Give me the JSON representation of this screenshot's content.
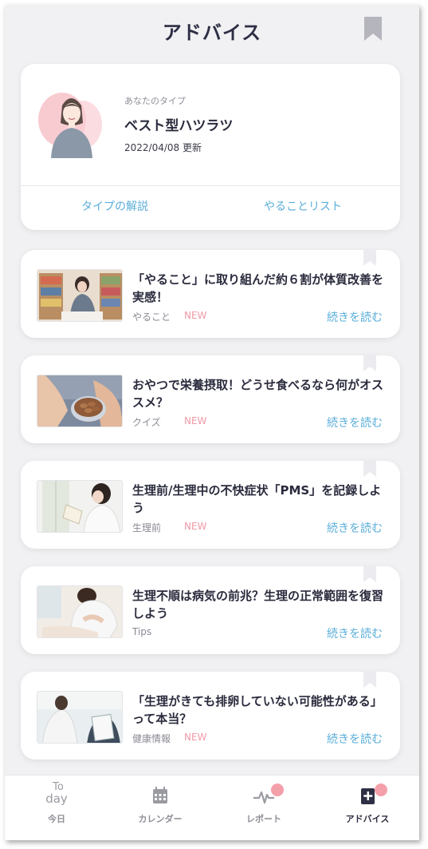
{
  "header": {
    "title": "アドバイス"
  },
  "type_card": {
    "caption": "あなたのタイプ",
    "name": "ベスト型ハツラツ",
    "updated": "2022/04/08 更新",
    "link_explanation": "タイプの解説",
    "link_todo": "やることリスト"
  },
  "articles": [
    {
      "title": "「やること」に取り組んだ約６割が体質改善を実感！",
      "category": "やること",
      "badge": "NEW",
      "more": "続きを読む"
    },
    {
      "title": "おやつで栄養摂取！どうせ食べるなら何がオススメ？",
      "category": "クイズ",
      "badge": "NEW",
      "more": "続きを読む"
    },
    {
      "title": "生理前/生理中の不快症状「PMS」を記録しよう",
      "category": "生理前",
      "badge": "NEW",
      "more": "続きを読む"
    },
    {
      "title": "生理不順は病気の前兆？生理の正常範囲を復習しよう",
      "category": "Tips",
      "badge": "",
      "more": "続きを読む"
    },
    {
      "title": "「生理がきても排卵していない可能性がある」って本当？",
      "category": "健康情報",
      "badge": "NEW",
      "more": "続きを読む"
    }
  ],
  "tabbar": {
    "today_icon_line1": "To",
    "today_icon_line2": "day",
    "today": "今日",
    "calendar": "カレンダー",
    "report": "レポート",
    "advice": "アドバイス"
  },
  "colors": {
    "accent_link": "#5aaed9",
    "new_badge": "#f09aa6",
    "notification_dot": "#f4a0aa",
    "background": "#f1f1f3"
  },
  "icons": [
    "bookmark-icon",
    "calendar-icon",
    "pulse-icon",
    "advice-plus-icon"
  ]
}
